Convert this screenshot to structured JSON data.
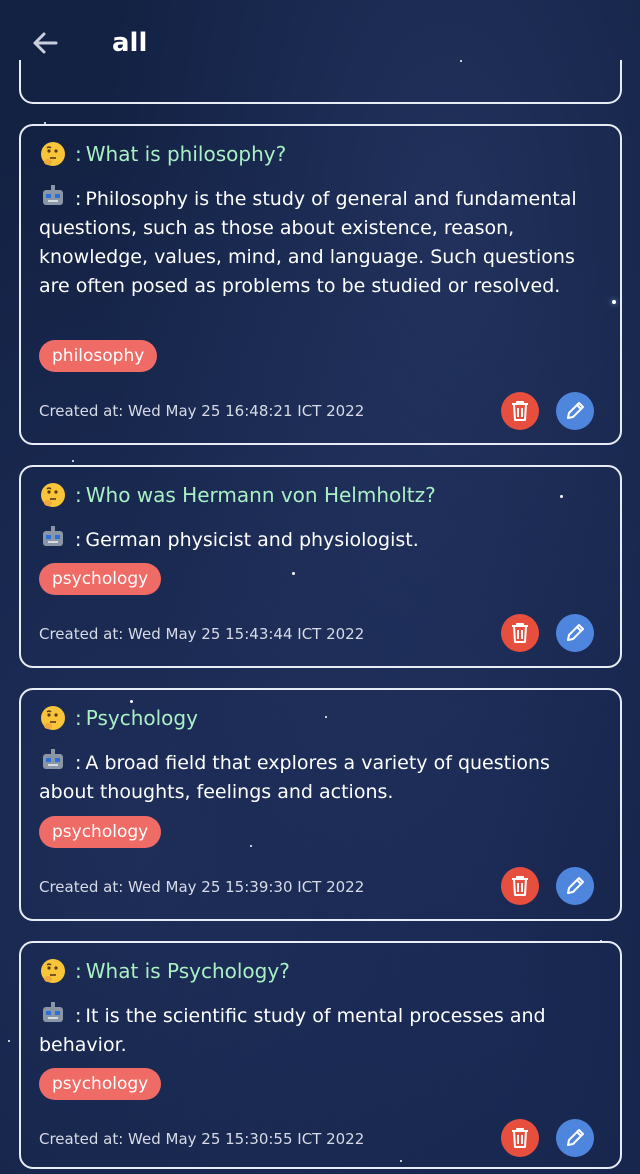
{
  "header": {
    "title": "all"
  },
  "cards": [
    {
      "question": "What is philosophy?",
      "answer": "Philosophy is the study of general and fundamental questions, such as those about existence, reason, knowledge, values, mind, and language. Such questions are often posed as problems to be studied or resolved.",
      "tag": "philosophy",
      "created": "Created at: Wed May 25 16:48:21 ICT 2022"
    },
    {
      "question": "Who was Hermann von Helmholtz?",
      "answer": "German physicist and physiologist.",
      "tag": "psychology",
      "created": "Created at: Wed May 25 15:43:44 ICT 2022"
    },
    {
      "question": "Psychology",
      "answer": "A broad field that explores a variety of questions about thoughts, feelings and actions.",
      "tag": "psychology",
      "created": "Created at: Wed May 25 15:39:30 ICT 2022"
    },
    {
      "question": "What is Psychology?",
      "answer": "It is the scientific study of mental processes and behavior.",
      "tag": "psychology",
      "created": "Created at: Wed May 25 15:30:55 ICT 2022"
    }
  ],
  "labels": {
    "separator": ":"
  },
  "icons": {
    "back": "arrow-left-icon",
    "question": "thinking-face-icon",
    "answer": "robot-icon",
    "delete": "trash-icon",
    "edit": "pencil-icon"
  },
  "colors": {
    "background": "#132143",
    "question_text": "#a9f0c4",
    "tag": "#ef6b66",
    "delete_button": "#e64e3e",
    "edit_button": "#4f86dd"
  }
}
